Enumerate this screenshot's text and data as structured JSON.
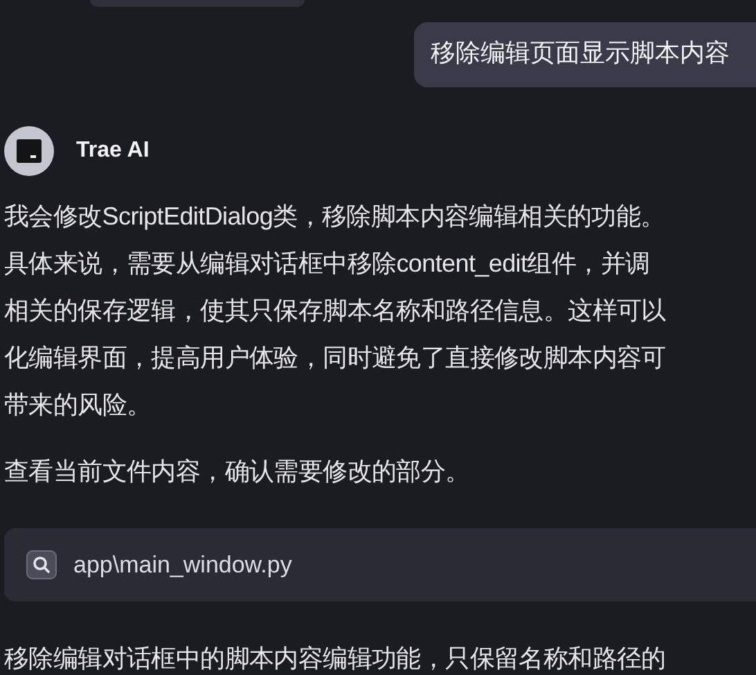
{
  "previous_message": {
    "kind": "bubble"
  },
  "user_message": {
    "text": "移除编辑页面显示脚本内容"
  },
  "assistant": {
    "name": "Trae AI"
  },
  "blocks": [
    {
      "kind": "paragraph",
      "lines": [
        "我会修改ScriptEditDialog类，移除脚本内容编辑相关的功能。",
        "具体来说，需要从编辑对话框中移除content_edit组件，并调",
        "相关的保存逻辑，使其只保存脚本名称和路径信息。这样可以",
        "化编辑界面，提高用户体验，同时避免了直接修改脚本内容可",
        "带来的风险。"
      ]
    },
    {
      "kind": "paragraph",
      "lines": [
        "查看当前文件内容，确认需要修改的部分。"
      ]
    },
    {
      "kind": "file",
      "path": "app\\main_window.py"
    },
    {
      "kind": "paragraph",
      "lines": [
        "移除编辑对话框中的脚本内容编辑功能，只保留名称和路径的"
      ]
    }
  ]
}
